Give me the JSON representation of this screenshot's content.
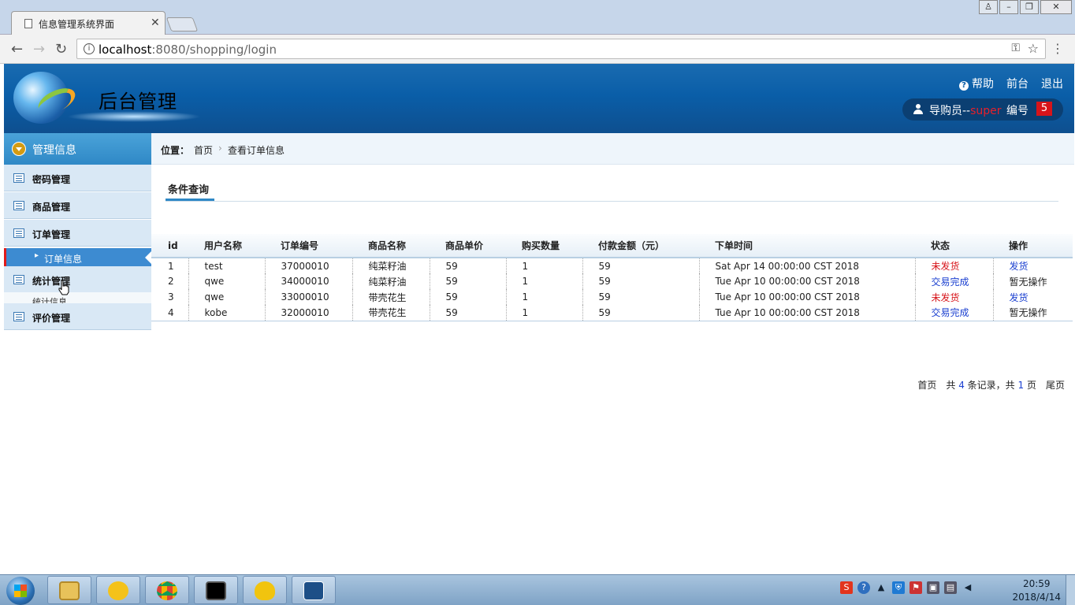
{
  "browser": {
    "tab_title": "信息管理系统界面",
    "url_host": "localhost",
    "url_rest": ":8080/shopping/login"
  },
  "header": {
    "app_title": "后台管理",
    "links": [
      "帮助",
      "前台",
      "退出"
    ],
    "user_label": "导购员--",
    "user_name": "super",
    "number_label": "编号",
    "number_value": "5"
  },
  "sidebar": {
    "head": "管理信息",
    "items": [
      "密码管理",
      "商品管理",
      "订单管理",
      "统计管理",
      "评价管理"
    ],
    "sub_active": "订单信息",
    "sub_partial": "统计信息"
  },
  "breadcrumb": {
    "label": "位置：",
    "home": "首页",
    "sep": "›",
    "current": "查看订单信息"
  },
  "query_tab": "条件查询",
  "table": {
    "columns": [
      "id",
      "用户名称",
      "订单编号",
      "商品名称",
      "商品单价",
      "购买数量",
      "付款金额（元）",
      "下单时间",
      "状态",
      "操作"
    ],
    "rows": [
      {
        "id": "1",
        "user": "test",
        "order_no": "37000010",
        "product": "纯菜籽油",
        "price": "59",
        "qty": "1",
        "amount": "59",
        "time": "Sat Apr 14 00:00:00 CST 2018",
        "status": "未发货",
        "op": "发货"
      },
      {
        "id": "2",
        "user": "qwe",
        "order_no": "34000010",
        "product": "纯菜籽油",
        "price": "59",
        "qty": "1",
        "amount": "59",
        "time": "Tue Apr 10 00:00:00 CST 2018",
        "status": "交易完成",
        "op": "暂无操作"
      },
      {
        "id": "3",
        "user": "qwe",
        "order_no": "33000010",
        "product": "带壳花生",
        "price": "59",
        "qty": "1",
        "amount": "59",
        "time": "Tue Apr 10 00:00:00 CST 2018",
        "status": "未发货",
        "op": "发货"
      },
      {
        "id": "4",
        "user": "kobe",
        "order_no": "32000010",
        "product": "带壳花生",
        "price": "59",
        "qty": "1",
        "amount": "59",
        "time": "Tue Apr 10 00:00:00 CST 2018",
        "status": "交易完成",
        "op": "暂无操作"
      }
    ]
  },
  "pager": {
    "first": "首页",
    "total_prefix": "共",
    "total_records": "4",
    "records_suffix": "条记录，共",
    "total_pages": "1",
    "pages_suffix": "页",
    "last": "尾页"
  },
  "taskbar": {
    "time": "20:59",
    "date": "2018/4/14"
  },
  "colors": {
    "header_blue": "#0a5ea8",
    "accent_red": "#d7141a",
    "link_blue": "#1a3fd0",
    "sidebar_item_bg": "#d9e8f5",
    "active_sub_bg": "#3d8bd1"
  },
  "icons": [
    "page-icon",
    "close-icon",
    "back-arrow-icon",
    "forward-arrow-icon",
    "reload-icon",
    "info-icon",
    "key-icon",
    "star-icon",
    "menu-dots-icon",
    "help-icon",
    "user-icon",
    "list-icon",
    "hand-cursor-icon"
  ]
}
